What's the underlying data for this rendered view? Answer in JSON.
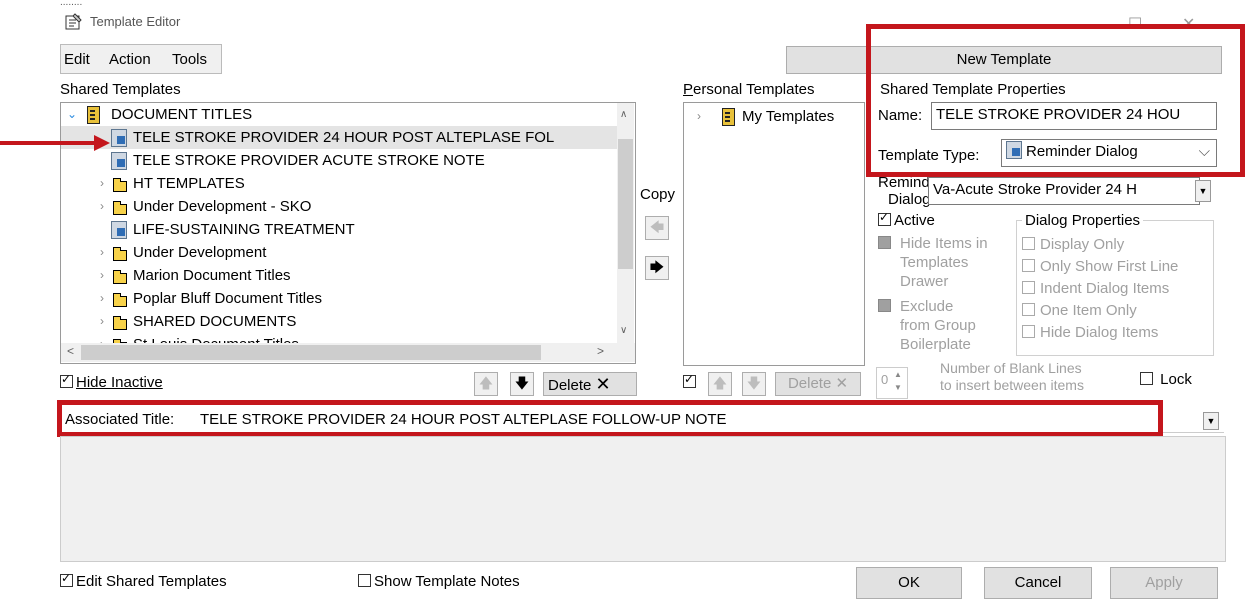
{
  "window": {
    "title": "Template Editor",
    "top_partial_text": "........"
  },
  "menu": {
    "edit": "Edit",
    "action": "Action",
    "tools": "Tools"
  },
  "new_template_button": "New Template",
  "shared": {
    "header": "Shared Templates",
    "items": [
      {
        "label": "DOCUMENT TITLES",
        "icon": "database-icon",
        "expanded": true
      },
      {
        "label": "TELE STROKE PROVIDER 24 HOUR POST ALTEPLASE FOL",
        "icon": "reminder-template-icon",
        "selected": true
      },
      {
        "label": "TELE STROKE PROVIDER ACUTE STROKE NOTE",
        "icon": "reminder-template-icon"
      },
      {
        "label": "HT TEMPLATES",
        "icon": "folder-icon"
      },
      {
        "label": "Under Development - SKO",
        "icon": "folder-icon"
      },
      {
        "label": "LIFE-SUSTAINING TREATMENT",
        "icon": "reminder-template-icon"
      },
      {
        "label": "Under Development",
        "icon": "folder-icon"
      },
      {
        "label": "Marion Document Titles",
        "icon": "folder-icon"
      },
      {
        "label": "Poplar Bluff Document Titles",
        "icon": "folder-icon"
      },
      {
        "label": "SHARED DOCUMENTS",
        "icon": "folder-icon"
      },
      {
        "label": "St Louis Document Titles",
        "icon": "folder-icon"
      }
    ],
    "hide_inactive": "Hide Inactive",
    "delete": "Delete"
  },
  "copy_label": "Copy",
  "personal": {
    "header": "Personal Templates",
    "items": [
      {
        "label": "My Templates",
        "icon": "database-icon"
      }
    ],
    "delete": "Delete"
  },
  "properties": {
    "header": "Shared Template Properties",
    "name_label": "Name:",
    "name_value": "TELE STROKE PROVIDER 24 HOU",
    "type_label": "Template Type:",
    "type_value": "Reminder Dialog",
    "reminder_dialog_label_1": "Reminder",
    "reminder_dialog_label_2": "Dialog:",
    "reminder_dialog_value": "Va-Acute Stroke Provider 24 H",
    "active": "Active",
    "hide_items": [
      "Hide Items in",
      "Templates",
      "Drawer"
    ],
    "exclude": [
      "Exclude",
      "from Group",
      "Boilerplate"
    ],
    "dialog_properties_header": "Dialog Properties",
    "dialog_options": [
      "Display Only",
      "Only Show First Line",
      "Indent Dialog Items",
      "One Item Only",
      "Hide Dialog Items"
    ],
    "blank_lines_value": "0",
    "blank_lines_label_1": "Number of Blank Lines",
    "blank_lines_label_2": "to insert between items",
    "lock": "Lock"
  },
  "associated_title": {
    "label": "Associated Title:",
    "value": "TELE STROKE PROVIDER 24 HOUR POST ALTEPLASE FOLLOW-UP NOTE"
  },
  "footer": {
    "edit_shared": "Edit Shared Templates",
    "show_notes": "Show Template Notes",
    "ok": "OK",
    "cancel": "Cancel",
    "apply": "Apply"
  },
  "annotation_color": "#c4161c"
}
